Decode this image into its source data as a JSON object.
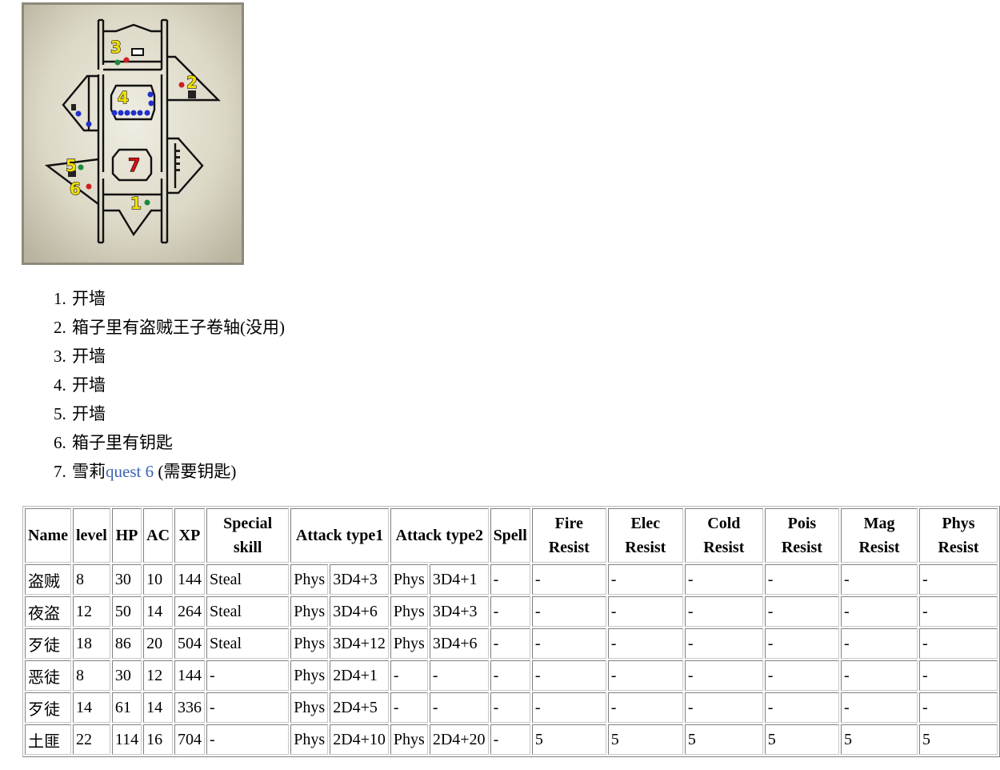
{
  "map": {
    "markers": [
      {
        "label": "1",
        "color": "#f0e000"
      },
      {
        "label": "2",
        "color": "#f0e000"
      },
      {
        "label": "3",
        "color": "#f0e000"
      },
      {
        "label": "4",
        "color": "#f0e000"
      },
      {
        "label": "5",
        "color": "#f0e000"
      },
      {
        "label": "6",
        "color": "#f0e000"
      },
      {
        "label": "7",
        "color": "#d01010"
      }
    ]
  },
  "notes": [
    {
      "text": "开墙"
    },
    {
      "text": "箱子里有盗贼王子卷轴(没用)"
    },
    {
      "text": "开墙"
    },
    {
      "text": "开墙"
    },
    {
      "text": "开墙"
    },
    {
      "text": "箱子里有钥匙"
    },
    {
      "text_before": "雪莉",
      "link_text": "quest 6",
      "text_after": " (需要钥匙)"
    }
  ],
  "table": {
    "headers": [
      "Name",
      "level",
      "HP",
      "AC",
      "XP",
      "Special skill",
      "Attack type1",
      "Attack type2",
      "Spell",
      "Fire Resist",
      "Elec Resist",
      "Cold Resist",
      "Pois Resist",
      "Mag Resist",
      "Phys Resist"
    ],
    "rows": [
      [
        "盗贼",
        "8",
        "30",
        "10",
        "144",
        "Steal",
        "Phys",
        "3D4+3",
        "Phys",
        "3D4+1",
        "-",
        "-",
        "-",
        "-",
        "-",
        "-",
        "-"
      ],
      [
        "夜盗",
        "12",
        "50",
        "14",
        "264",
        "Steal",
        "Phys",
        "3D4+6",
        "Phys",
        "3D4+3",
        "-",
        "-",
        "-",
        "-",
        "-",
        "-",
        "-"
      ],
      [
        "歹徒",
        "18",
        "86",
        "20",
        "504",
        "Steal",
        "Phys",
        "3D4+12",
        "Phys",
        "3D4+6",
        "-",
        "-",
        "-",
        "-",
        "-",
        "-",
        "-"
      ],
      [
        "恶徒",
        "8",
        "30",
        "12",
        "144",
        "-",
        "Phys",
        "2D4+1",
        "-",
        "-",
        "-",
        "-",
        "-",
        "-",
        "-",
        "-",
        "-"
      ],
      [
        "歹徒",
        "14",
        "61",
        "14",
        "336",
        "-",
        "Phys",
        "2D4+5",
        "-",
        "-",
        "-",
        "-",
        "-",
        "-",
        "-",
        "-",
        "-"
      ],
      [
        "土匪",
        "22",
        "114",
        "16",
        "704",
        "-",
        "Phys",
        "2D4+10",
        "Phys",
        "2D4+20",
        "-",
        "5",
        "5",
        "5",
        "5",
        "5",
        "5"
      ]
    ]
  }
}
